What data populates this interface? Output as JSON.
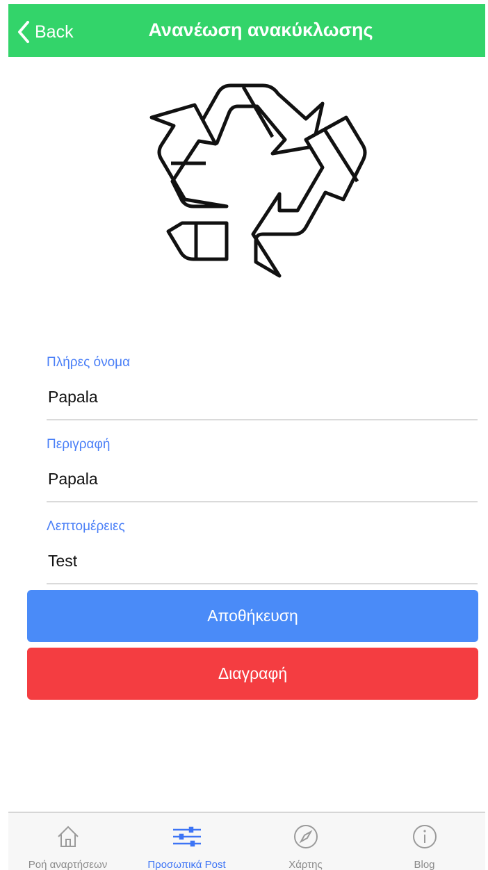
{
  "header": {
    "back_label": "Back",
    "title": "Ανανέωση ανακύκλωσης",
    "background_color": "#33d46a"
  },
  "hero": {
    "icon": "recycle-icon"
  },
  "form": {
    "fields": [
      {
        "label": "Πλήρες όνομα",
        "value": "Papala"
      },
      {
        "label": "Περιγραφή",
        "value": "Papala"
      },
      {
        "label": "Λεπτομέρειες",
        "value": "Test"
      }
    ],
    "label_color": "#4a7ff7"
  },
  "actions": {
    "save_label": "Αποθήκευση",
    "save_color": "#4a8bf8",
    "delete_label": "Διαγραφή",
    "delete_color": "#f43d41"
  },
  "tabbar": {
    "active_tab": "Προσωπικά Post",
    "active_color": "#3d74f5",
    "tabs": [
      {
        "label": "Ροή αναρτήσεων",
        "icon": "home-icon"
      },
      {
        "label": "Προσωπικά Post",
        "icon": "sliders-icon"
      },
      {
        "label": "Χάρτης",
        "icon": "compass-icon"
      },
      {
        "label": "Blog",
        "icon": "info-icon"
      }
    ]
  }
}
